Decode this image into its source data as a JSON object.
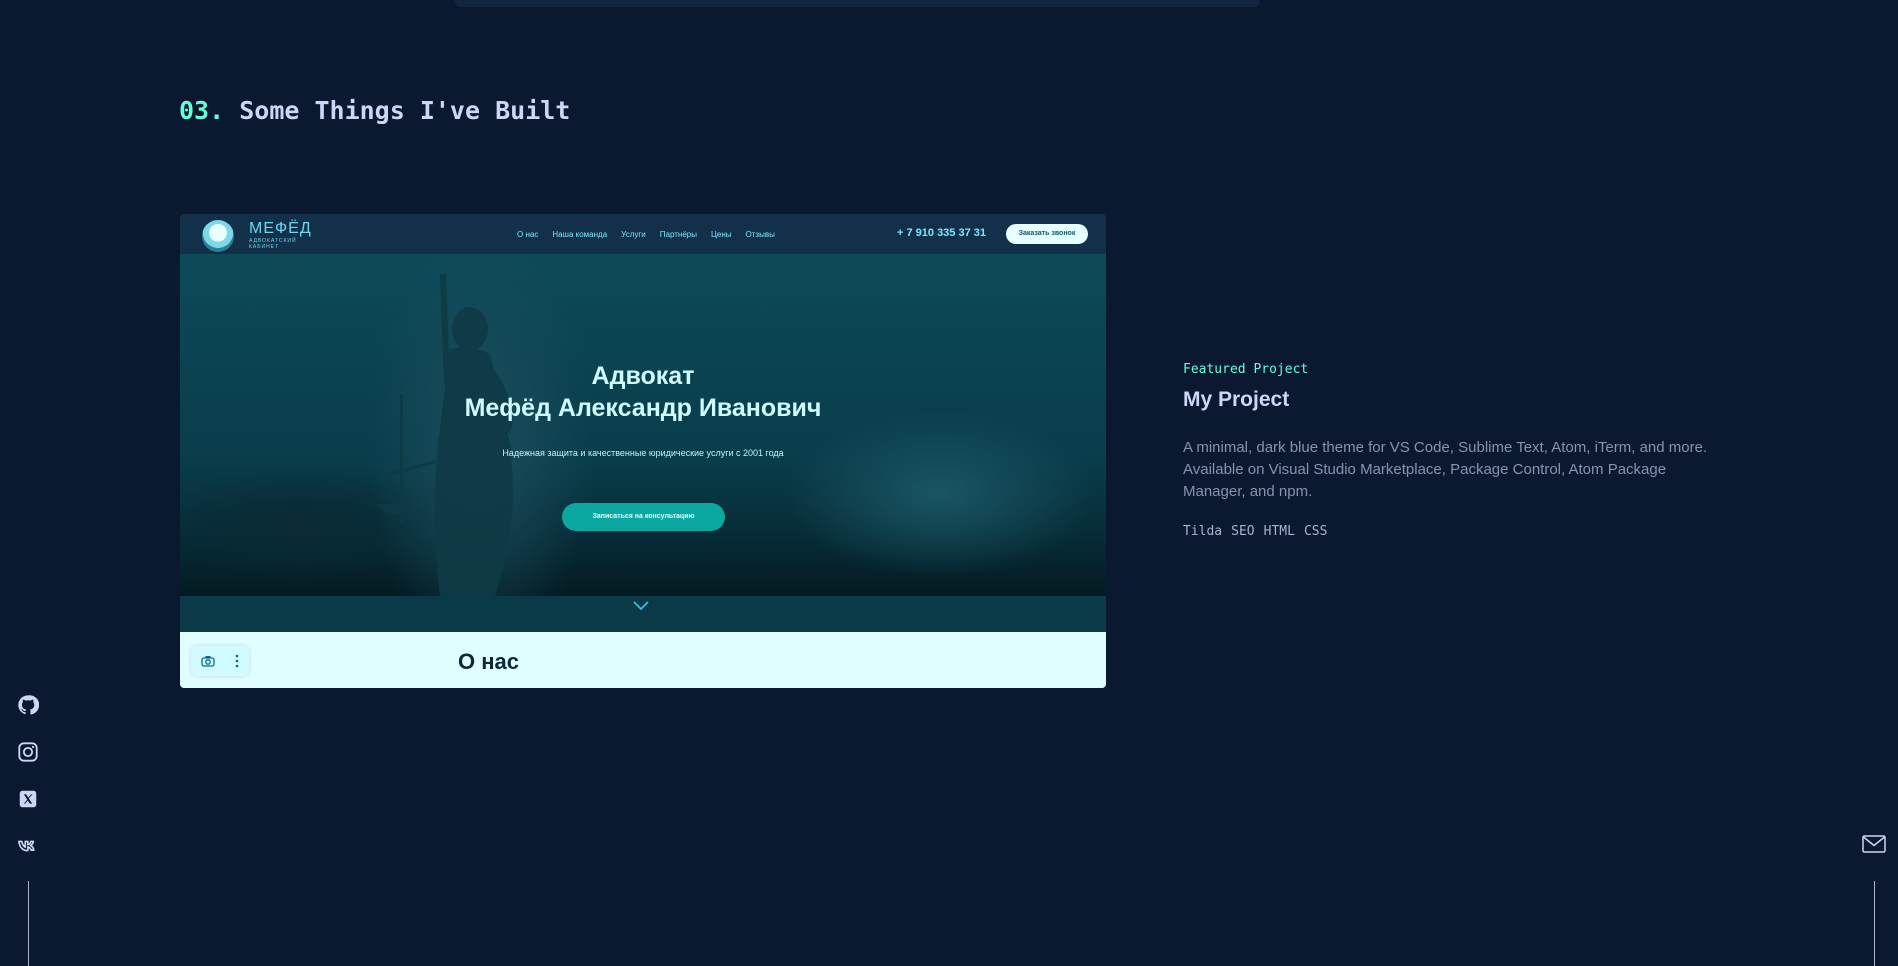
{
  "section": {
    "number": "03.",
    "title": "Some Things I've Built"
  },
  "project": {
    "overline": "Featured Project",
    "title": "My Project",
    "description": "A minimal, dark blue theme for VS Code, Sublime Text, Atom, iTerm, and more. Available on Visual Studio Marketplace, Package Control, Atom Package Manager, and npm.",
    "tech": [
      "Tilda",
      "SEO",
      "HTML",
      "CSS"
    ]
  },
  "preview": {
    "logo_text": "МЕФЁД",
    "logo_sub": "АДВОКАТСКИЙ КАБИНЕТ",
    "menu": [
      "О нас",
      "Наша команда",
      "Услуги",
      "Партнёры",
      "Цены",
      "Отзывы"
    ],
    "phone": "+ 7 910 335 37 31",
    "call_button": "Заказать звонок",
    "hero_title_1": "Адвокат",
    "hero_title_2": "Мефёд Александр Иванович",
    "hero_subtitle": "Надежная защита и качественные юридические услуги с 2001 года",
    "cta": "Записаться на консультацию",
    "about_heading": "О нас",
    "toolbar_icons": [
      "camera-icon",
      "more-vertical-icon"
    ]
  },
  "social": [
    "github-icon",
    "instagram-icon",
    "x-icon",
    "vk-icon"
  ],
  "colors": {
    "background": "#0b1930",
    "accent": "#64ffda",
    "heading": "#ccd6f6",
    "text": "#8892b0"
  }
}
